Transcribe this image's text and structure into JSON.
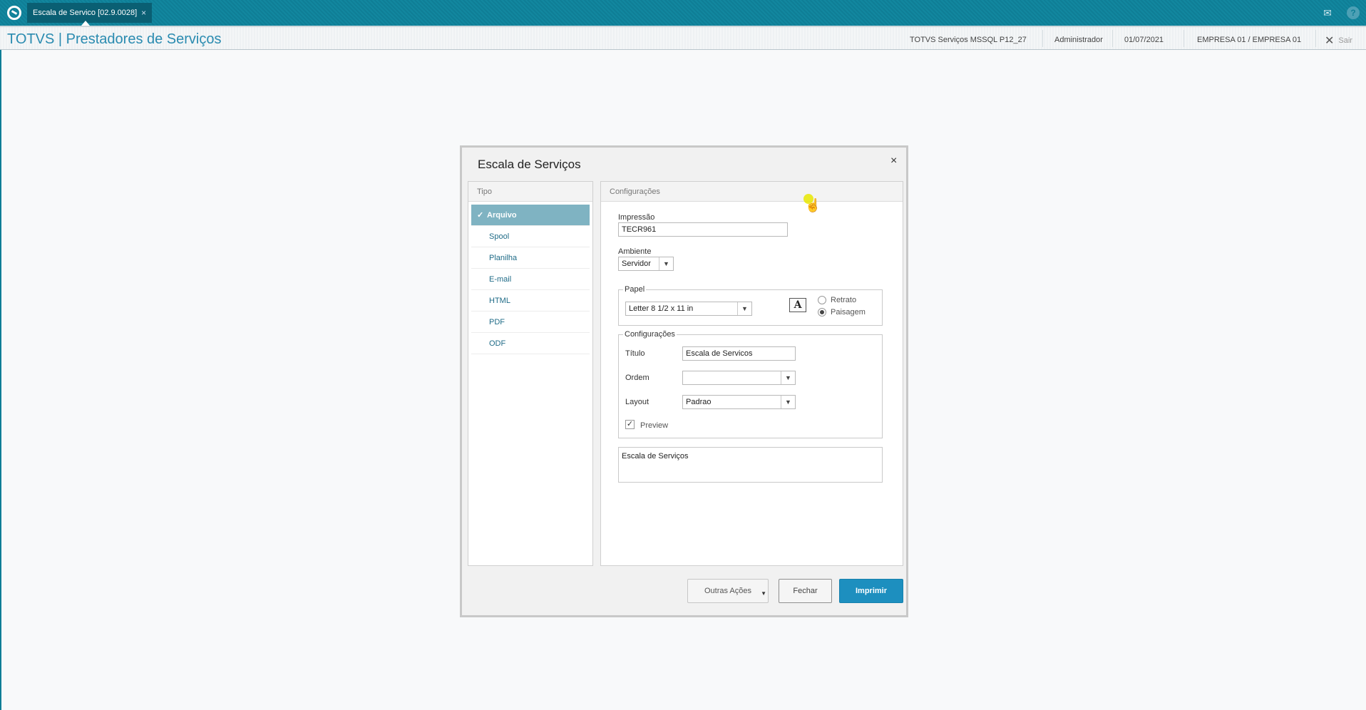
{
  "topbar": {
    "tab_label": "Escala de Servico [02.9.0028]",
    "tab_close": "×",
    "mail_icon": "mail-icon",
    "help_icon": "help-icon",
    "help_glyph": "?"
  },
  "header": {
    "app_title": "TOTVS | Prestadores de Serviços",
    "environment": "TOTVS Serviços MSSQL P12_27",
    "user": "Administrador",
    "date": "01/07/2021",
    "company": "EMPRESA 01 / EMPRESA 01",
    "exit_label": "Sair",
    "exit_glyph": "✕"
  },
  "dialog": {
    "title": "Escala de Serviços",
    "close_glyph": "×",
    "tipo": {
      "header": "Tipo",
      "items": [
        {
          "label": "Arquivo",
          "active": true
        },
        {
          "label": "Spool"
        },
        {
          "label": "Planilha"
        },
        {
          "label": "E-mail"
        },
        {
          "label": "HTML"
        },
        {
          "label": "PDF"
        },
        {
          "label": "ODF"
        }
      ],
      "check_glyph": "✓"
    },
    "config": {
      "header": "Configurações",
      "impressao_label": "Impressão",
      "impressao_value": "TECR961",
      "ambiente_label": "Ambiente",
      "ambiente_value": "Servidor",
      "papel": {
        "legend": "Papel",
        "value": "Letter 8 1/2 x 11 in",
        "font_glyph": "A",
        "retrato_label": "Retrato",
        "paisagem_label": "Paisagem",
        "orientation": "Paisagem"
      },
      "configuracoes": {
        "legend": "Configurações",
        "titulo_label": "Título",
        "titulo_value": "Escala de Servicos",
        "ordem_label": "Ordem",
        "ordem_value": "",
        "layout_label": "Layout",
        "layout_value": "Padrao",
        "preview_label": "Preview",
        "preview_checked": true,
        "check_glyph": "✓"
      },
      "description": "Escala de Serviços"
    },
    "buttons": {
      "outras": "Outras Ações",
      "fechar": "Fechar",
      "imprimir": "Imprimir"
    }
  },
  "colors": {
    "topbar": "#0f7e96",
    "accent": "#1d8fbf",
    "active_item": "#7fb3c2",
    "title": "#2a8bb0"
  }
}
